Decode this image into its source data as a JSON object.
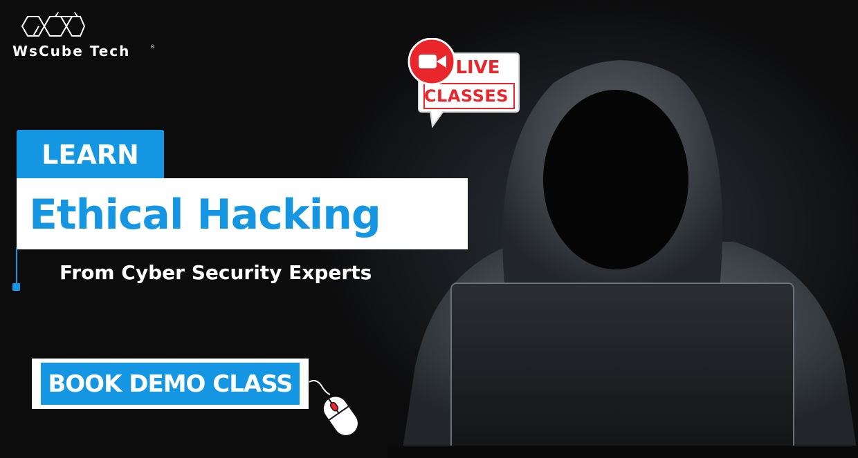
{
  "brand": {
    "logo_text": "WsCube Tech",
    "registered_mark": "®",
    "logo_icon": "hexagon-honeycomb-icon"
  },
  "badge": {
    "icon": "video-camera-icon",
    "live": "LIVE",
    "classes": "CLASSES"
  },
  "headline": {
    "learn": "LEARN",
    "title": "Ethical Hacking",
    "subtitle": "From Cyber Security Experts"
  },
  "cta": {
    "label": "BOOK DEMO CLASS",
    "pointer_icon": "computer-mouse-icon"
  },
  "image": {
    "subject": "hooded-hacker-with-laptop"
  },
  "colors": {
    "accent_blue": "#1596e3",
    "live_red": "#e8262c",
    "background": "#0c0c0d"
  }
}
